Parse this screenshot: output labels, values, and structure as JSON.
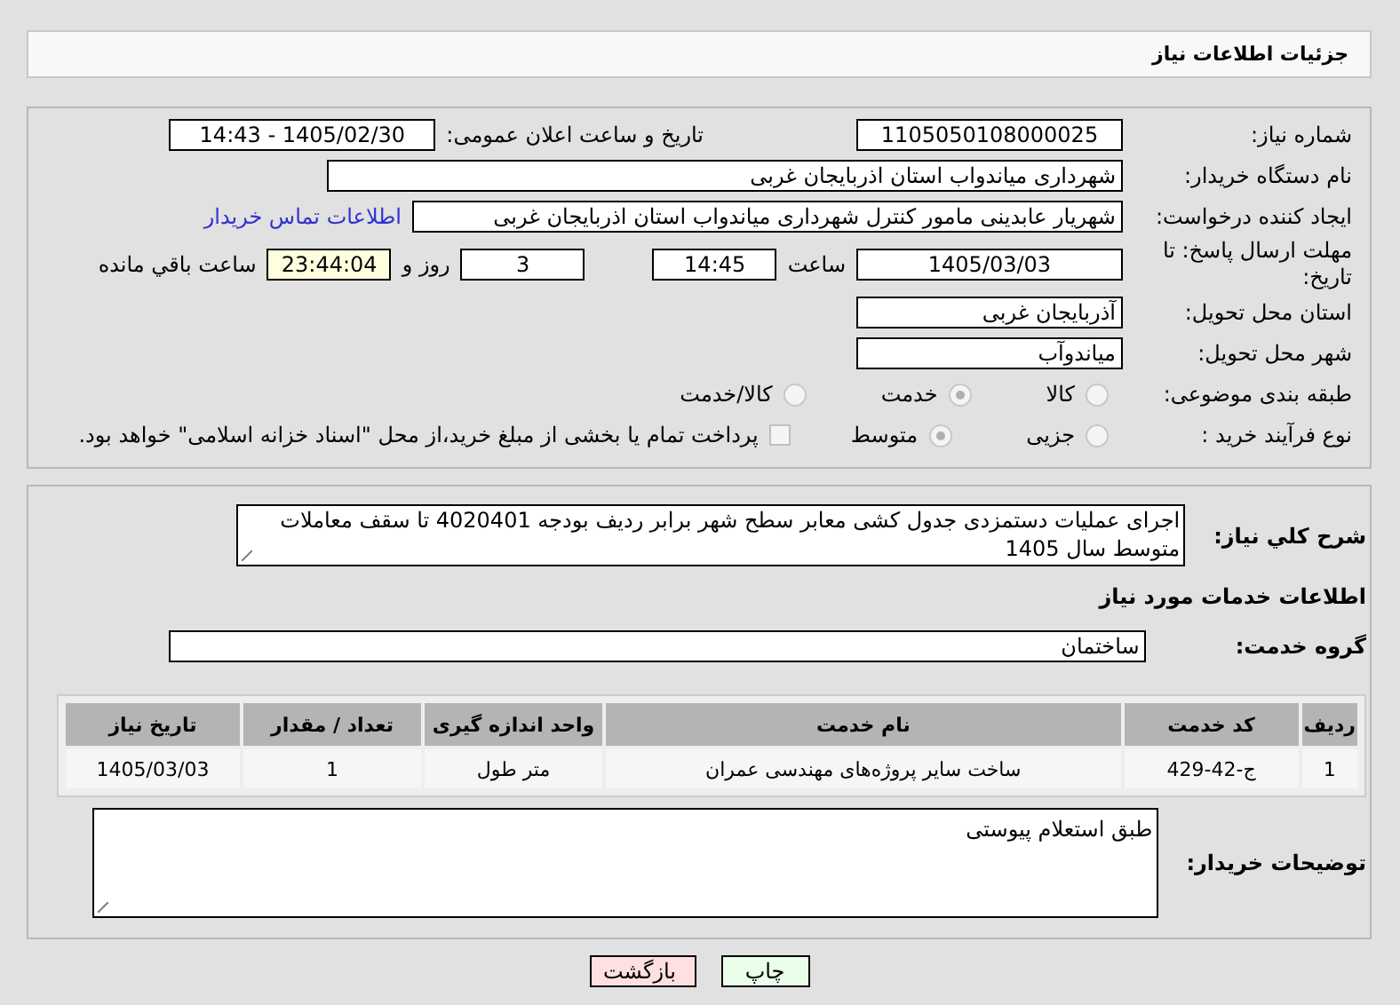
{
  "header": {
    "title": "جزئیات اطلاعات نیاز"
  },
  "need_number": {
    "label": "شماره نیاز:",
    "value": "1105050108000025"
  },
  "announce": {
    "label": "تاریخ و ساعت اعلان عمومی:",
    "value": "1405/02/30 - 14:43"
  },
  "buyer": {
    "label": "نام دستگاه خریدار:",
    "value": "شهرداری میاندواب استان اذربایجان غربی"
  },
  "requester": {
    "label": "ایجاد کننده درخواست:",
    "value": "شهریار  عابدینی مامور کنترل شهرداری میاندواب استان اذربایجان غربی",
    "link": "اطلاعات تماس خریدار"
  },
  "deadline": {
    "label": "مهلت ارسال پاسخ: تا تاریخ:",
    "date": "1405/03/03",
    "time_label": "ساعت",
    "time": "14:45",
    "days": "3",
    "days_label": "روز و",
    "remaining": "23:44:04",
    "remaining_label": "ساعت باقي مانده"
  },
  "province": {
    "label": "استان محل تحویل:",
    "value": "آذربایجان غربی"
  },
  "city": {
    "label": "شهر محل تحویل:",
    "value": "میاندوآب"
  },
  "category": {
    "label": "طبقه بندی موضوعی:",
    "options": [
      {
        "label": "کالا",
        "selected": false
      },
      {
        "label": "خدمت",
        "selected": true
      },
      {
        "label": "کالا/خدمت",
        "selected": false
      }
    ]
  },
  "purchase_type": {
    "label": "نوع فرآیند خرید :",
    "options": [
      {
        "label": "جزیی",
        "selected": false
      },
      {
        "label": "متوسط",
        "selected": true
      }
    ],
    "treasury": {
      "label": "پرداخت تمام یا بخشی از مبلغ خرید،از محل \"اسناد خزانه اسلامی\" خواهد بود.",
      "checked": false
    }
  },
  "description": {
    "label": "شرح کلي نياز:",
    "value": "اجرای عملیات دستمزدی جدول کشی معابر سطح شهر  برابر ردیف بودجه 4020401 تا سقف معاملات  متوسط سال 1405"
  },
  "services_heading": "اطلاعات خدمات مورد نیاز",
  "service_group": {
    "label": "گروه خدمت:",
    "value": "ساختمان"
  },
  "table": {
    "columns": [
      "ردیف",
      "کد خدمت",
      "نام خدمت",
      "واحد اندازه گیری",
      "تعداد / مقدار",
      "تاریخ نیاز"
    ],
    "rows": [
      [
        "1",
        "ج-42-429",
        "ساخت سایر پروژه‌های مهندسی عمران",
        "متر طول",
        "1",
        "1405/03/03"
      ]
    ]
  },
  "buyer_notes": {
    "label": "توضیحات خریدار:",
    "value": "طبق استعلام پیوستی"
  },
  "buttons": [
    {
      "label": "چاپ",
      "kind": "print"
    },
    {
      "label": "بازگشت",
      "kind": "back"
    }
  ]
}
